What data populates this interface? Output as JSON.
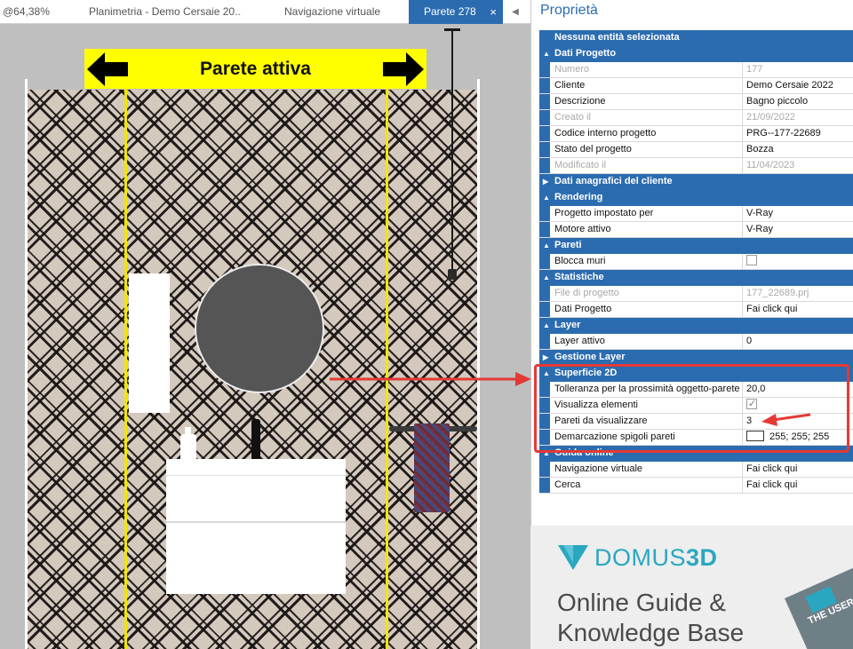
{
  "tabs": [
    {
      "label": "@64,38%",
      "active": false
    },
    {
      "label": "Planimetria - Demo Cersaie 20...",
      "active": false
    },
    {
      "label": "Navigazione virtuale",
      "active": false
    },
    {
      "label": "Parete 278",
      "active": true
    }
  ],
  "active_tab_close": "×",
  "tab_scroll": "◀ ▶",
  "viewport": {
    "banner_label": "Parete attiva"
  },
  "panel": {
    "title": "Proprietà",
    "rows": [
      {
        "type": "section",
        "label": "Nessuna entità selezionata",
        "toggle": ""
      },
      {
        "type": "section",
        "label": "Dati Progetto",
        "toggle": "▲"
      },
      {
        "type": "prop",
        "key": "Numero",
        "value": "177",
        "disabled": true
      },
      {
        "type": "prop",
        "key": "Cliente",
        "value": "Demo Cersaie 2022"
      },
      {
        "type": "prop",
        "key": "Descrizione",
        "value": "Bagno piccolo"
      },
      {
        "type": "prop",
        "key": "Creato il",
        "value": "21/09/2022",
        "disabled": true
      },
      {
        "type": "prop",
        "key": "Codice interno progetto",
        "value": "PRG--177-22689"
      },
      {
        "type": "prop",
        "key": "Stato del progetto",
        "value": "Bozza"
      },
      {
        "type": "prop",
        "key": "Modificato il",
        "value": "11/04/2023",
        "disabled": true
      },
      {
        "type": "section",
        "label": "Dati anagrafici del cliente",
        "toggle": "▶"
      },
      {
        "type": "section",
        "label": "Rendering",
        "toggle": "▲"
      },
      {
        "type": "prop",
        "key": "Progetto impostato per",
        "value": "V-Ray"
      },
      {
        "type": "prop",
        "key": "Motore attivo",
        "value": "V-Ray"
      },
      {
        "type": "section",
        "label": "Pareti",
        "toggle": "▲"
      },
      {
        "type": "prop",
        "key": "Blocca muri",
        "value": "",
        "checkbox": "unchecked"
      },
      {
        "type": "section",
        "label": "Statistiche",
        "toggle": "▲"
      },
      {
        "type": "prop",
        "key": "File di progetto",
        "value": "177_22689.prj",
        "disabled": true
      },
      {
        "type": "prop",
        "key": "Dati Progetto",
        "value": "Fai click qui"
      },
      {
        "type": "section",
        "label": "Layer",
        "toggle": "▲"
      },
      {
        "type": "prop",
        "key": "Layer attivo",
        "value": "0"
      },
      {
        "type": "section",
        "label": "Gestione Layer",
        "toggle": "▶"
      },
      {
        "type": "section",
        "label": "Superficie 2D",
        "toggle": "▲"
      },
      {
        "type": "prop",
        "key": "Tolleranza per la prossimità oggetto-parete",
        "value": "20,0"
      },
      {
        "type": "prop",
        "key": "Visualizza elementi",
        "value": "",
        "checkbox": "checked"
      },
      {
        "type": "prop",
        "key": "Pareti da visualizzare",
        "value": "3"
      },
      {
        "type": "prop",
        "key": "Demarcazione spigoli pareti",
        "value": "255; 255; 255",
        "swatch": "#ffffff"
      },
      {
        "type": "section",
        "label": "Guida online",
        "toggle": "▲"
      },
      {
        "type": "prop",
        "key": "Navigazione virtuale",
        "value": "Fai click qui"
      },
      {
        "type": "prop",
        "key": "Cerca",
        "value": "Fai click qui"
      }
    ]
  },
  "brand": {
    "name_light": "DOMUS",
    "name_bold": "3D",
    "tagline_line1": "Online Guide &",
    "tagline_line2": "Knowledge Base",
    "book_text": "THE USER GUIDE"
  },
  "colors": {
    "accent": "#2b6cb0",
    "highlight": "#e53935",
    "banner": "#ffff00",
    "guide_line": "#f2e600",
    "brand": "#2aa7c0"
  }
}
